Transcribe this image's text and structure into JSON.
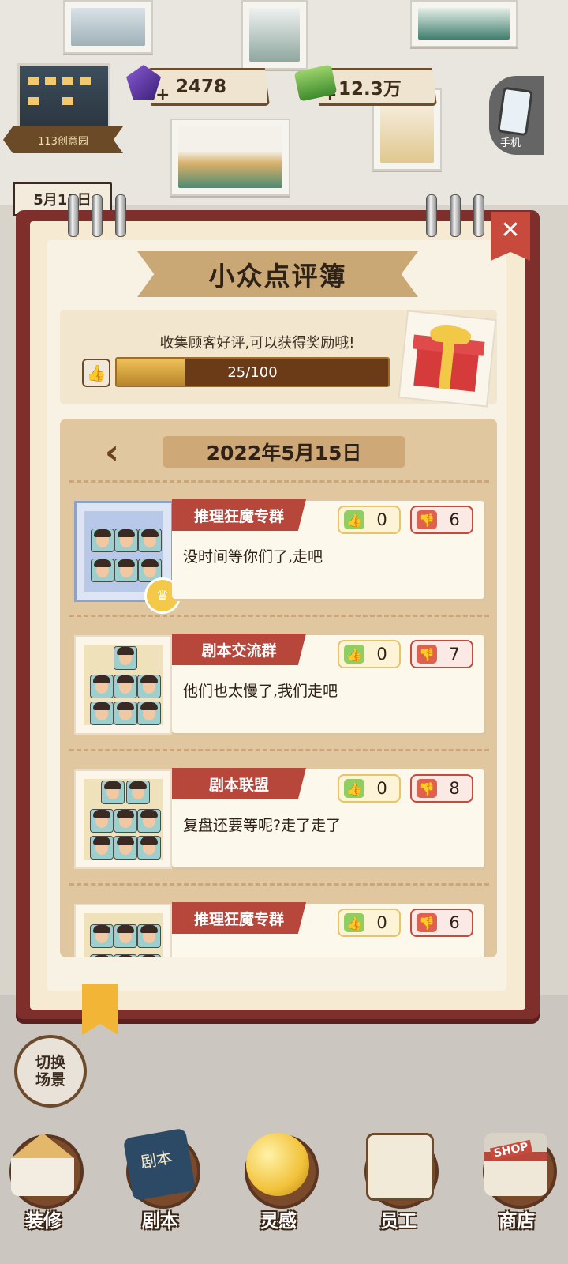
{
  "hud": {
    "park_name": "113创意园",
    "gems": "2478",
    "cash": "12.3万",
    "phone_label": "手机",
    "date_sign": "5月15日"
  },
  "dialog": {
    "title": "小众点评簿",
    "hint": "收集顾客好评,可以获得奖励哦!",
    "progress": {
      "current": 25,
      "total": 100,
      "label": "25/100"
    },
    "date": "2022年5月15日",
    "reviews": [
      {
        "group": "推理狂魔专群",
        "likes": "0",
        "dislikes": "6",
        "comment": "没时间等你们了,走吧",
        "selected": true
      },
      {
        "group": "剧本交流群",
        "likes": "0",
        "dislikes": "7",
        "comment": "他们也太慢了,我们走吧",
        "selected": false
      },
      {
        "group": "剧本联盟",
        "likes": "0",
        "dislikes": "8",
        "comment": "复盘还要等呢?走了走了",
        "selected": false
      },
      {
        "group": "推理狂魔专群",
        "likes": "0",
        "dislikes": "6",
        "comment": "",
        "selected": false
      }
    ]
  },
  "switch_scene": {
    "line1": "切换",
    "line2": "场景"
  },
  "dock": {
    "decorate": "装修",
    "script": "剧本",
    "script_cover": "剧本",
    "inspiration": "灵感",
    "staff": "员工",
    "shop": "商店",
    "shop_sign": "SHOP"
  },
  "icons": {
    "close": "close-icon",
    "back": "back-chevron-icon",
    "like": "thumbs-up-icon",
    "dislike": "thumbs-down-icon",
    "gift": "gift-box-icon",
    "gem": "gem-icon",
    "cash": "cash-icon"
  },
  "colors": {
    "book_cover": "#7e2f2b",
    "tag_red": "#b8473b",
    "progress_fill": "#f0c15a",
    "like_green": "#8fcf62",
    "dislike_red": "#e0604f"
  }
}
